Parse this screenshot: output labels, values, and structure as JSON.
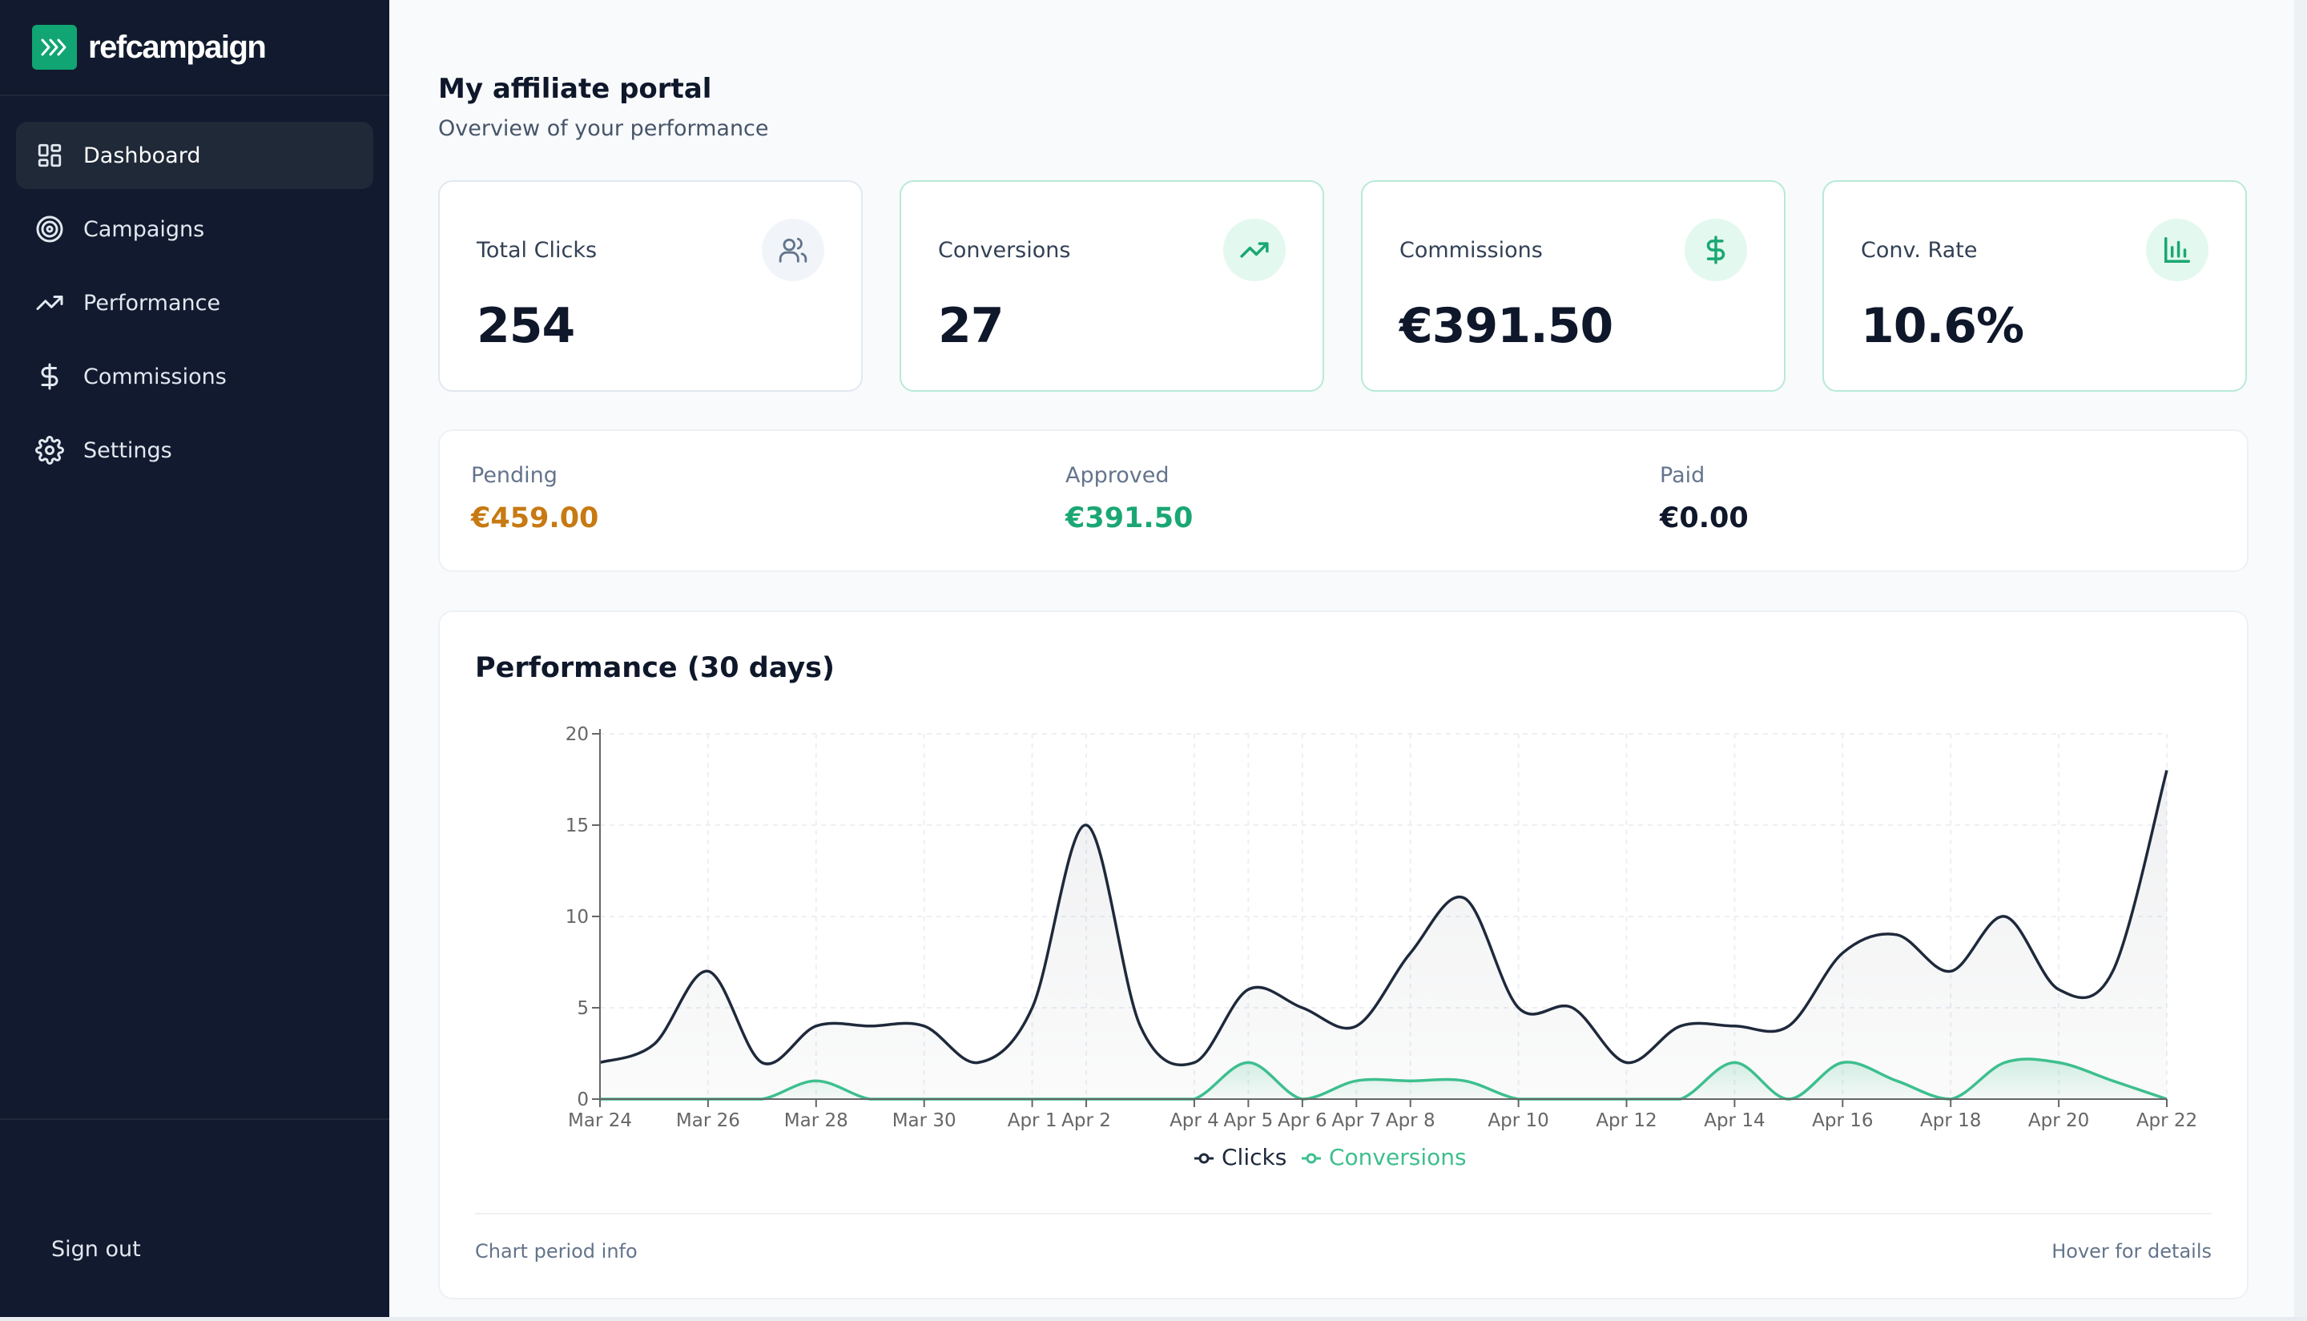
{
  "brand": {
    "name": "refcampaign"
  },
  "sidebar": {
    "items": [
      {
        "label": "Dashboard",
        "icon": "dashboard-icon",
        "active": true
      },
      {
        "label": "Campaigns",
        "icon": "target-icon",
        "active": false
      },
      {
        "label": "Performance",
        "icon": "trending-up-icon",
        "active": false
      },
      {
        "label": "Commissions",
        "icon": "dollar-icon",
        "active": false
      },
      {
        "label": "Settings",
        "icon": "gear-icon",
        "active": false
      }
    ],
    "sign_out": "Sign out"
  },
  "header": {
    "title": "My affiliate portal",
    "subtitle": "Overview of your performance"
  },
  "stats": [
    {
      "label": "Total Clicks",
      "value": "254",
      "icon": "users-icon"
    },
    {
      "label": "Conversions",
      "value": "27",
      "icon": "trending-up-icon"
    },
    {
      "label": "Commissions",
      "value": "€391.50",
      "icon": "dollar-icon"
    },
    {
      "label": "Conv. Rate",
      "value": "10.6%",
      "icon": "bar-chart-icon"
    }
  ],
  "balances": {
    "pending": {
      "label": "Pending",
      "value": "€459.00"
    },
    "approved": {
      "label": "Approved",
      "value": "€391.50"
    },
    "paid": {
      "label": "Paid",
      "value": "€0.00"
    }
  },
  "colors": {
    "sidebar": "#111a2e",
    "accent": "#10a572",
    "pending": "#c77a12",
    "clicks": "#1e293b",
    "conversions": "#3dbf8e"
  },
  "chart": {
    "title": "Performance (30 days)",
    "footer_left": "Chart period info",
    "footer_right": "Hover for details"
  },
  "chart_data": {
    "type": "line",
    "title": "Performance (30 days)",
    "x": [
      "Mar 24",
      "Mar 25",
      "Mar 26",
      "Mar 27",
      "Mar 28",
      "Mar 29",
      "Mar 30",
      "Mar 31",
      "Apr 1",
      "Apr 2",
      "Apr 3",
      "Apr 4",
      "Apr 5",
      "Apr 6",
      "Apr 7",
      "Apr 8",
      "Apr 9",
      "Apr 10",
      "Apr 11",
      "Apr 12",
      "Apr 13",
      "Apr 14",
      "Apr 15",
      "Apr 16",
      "Apr 17",
      "Apr 18",
      "Apr 19",
      "Apr 20",
      "Apr 21",
      "Apr 22"
    ],
    "x_ticks": [
      "Mar 24",
      "Mar 26",
      "Mar 28",
      "Mar 30",
      "Apr 1",
      "Apr 2",
      "Apr 4",
      "Apr 5",
      "Apr 6",
      "Apr 7",
      "Apr 8",
      "Apr 10",
      "Apr 12",
      "Apr 14",
      "Apr 16",
      "Apr 18",
      "Apr 20",
      "Apr 22"
    ],
    "series": [
      {
        "name": "Clicks",
        "values": [
          2,
          3,
          7,
          2,
          4,
          4,
          4,
          2,
          5,
          15,
          4,
          2,
          6,
          5,
          4,
          8,
          11,
          5,
          5,
          2,
          4,
          4,
          4,
          8,
          9,
          7,
          10,
          6,
          7,
          18
        ]
      },
      {
        "name": "Conversions",
        "values": [
          0,
          0,
          0,
          0,
          1,
          0,
          0,
          0,
          0,
          0,
          0,
          0,
          2,
          0,
          1,
          1,
          1,
          0,
          0,
          0,
          0,
          2,
          0,
          2,
          1,
          0,
          2,
          2,
          1,
          0
        ]
      }
    ],
    "ylim": [
      0,
      20
    ],
    "y_ticks": [
      0,
      5,
      10,
      15,
      20
    ],
    "grid": true,
    "legend": "bottom"
  }
}
